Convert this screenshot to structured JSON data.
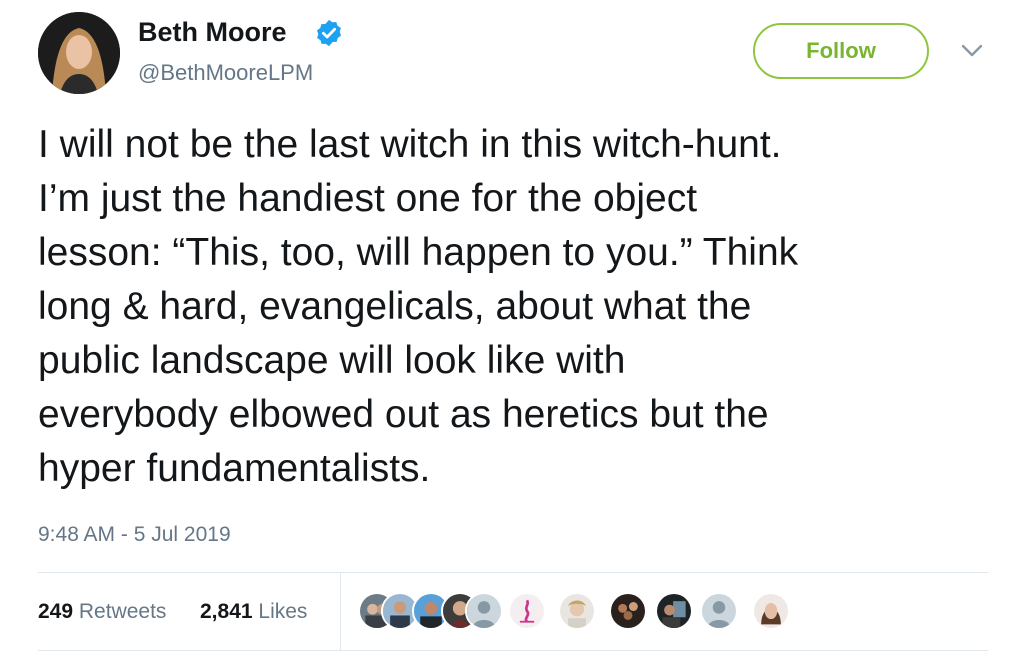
{
  "user": {
    "display_name": "Beth Moore",
    "handle": "@BethMooreLPM",
    "verified": true
  },
  "actions": {
    "follow_label": "Follow"
  },
  "tweet": {
    "text": "I will not be the last witch in this witch-hunt.\nI’m just the handiest one for the object\nlesson: “This, too, will happen to you.” Think\nlong & hard, evangelicals, about what the\npublic landscape will look like with\neverybody elbowed out as heretics but the\nhyper fundamentalists.",
    "timestamp": "9:48 AM - 5 Jul 2019"
  },
  "stats": {
    "retweets_count": "249",
    "retweets_label": "Retweets",
    "likes_count": "2,841",
    "likes_label": "Likes"
  },
  "colors": {
    "accent_green": "#79b530",
    "verified_blue": "#1da1f2",
    "secondary_text": "#657786"
  },
  "liker_avatars": [
    {
      "name": "liker-avatar-1"
    },
    {
      "name": "liker-avatar-2"
    },
    {
      "name": "liker-avatar-3"
    },
    {
      "name": "liker-avatar-4"
    },
    {
      "name": "liker-avatar-5"
    },
    {
      "name": "liker-avatar-6"
    },
    {
      "name": "liker-avatar-7"
    },
    {
      "name": "liker-avatar-8"
    },
    {
      "name": "liker-avatar-9"
    },
    {
      "name": "liker-avatar-10"
    }
  ]
}
